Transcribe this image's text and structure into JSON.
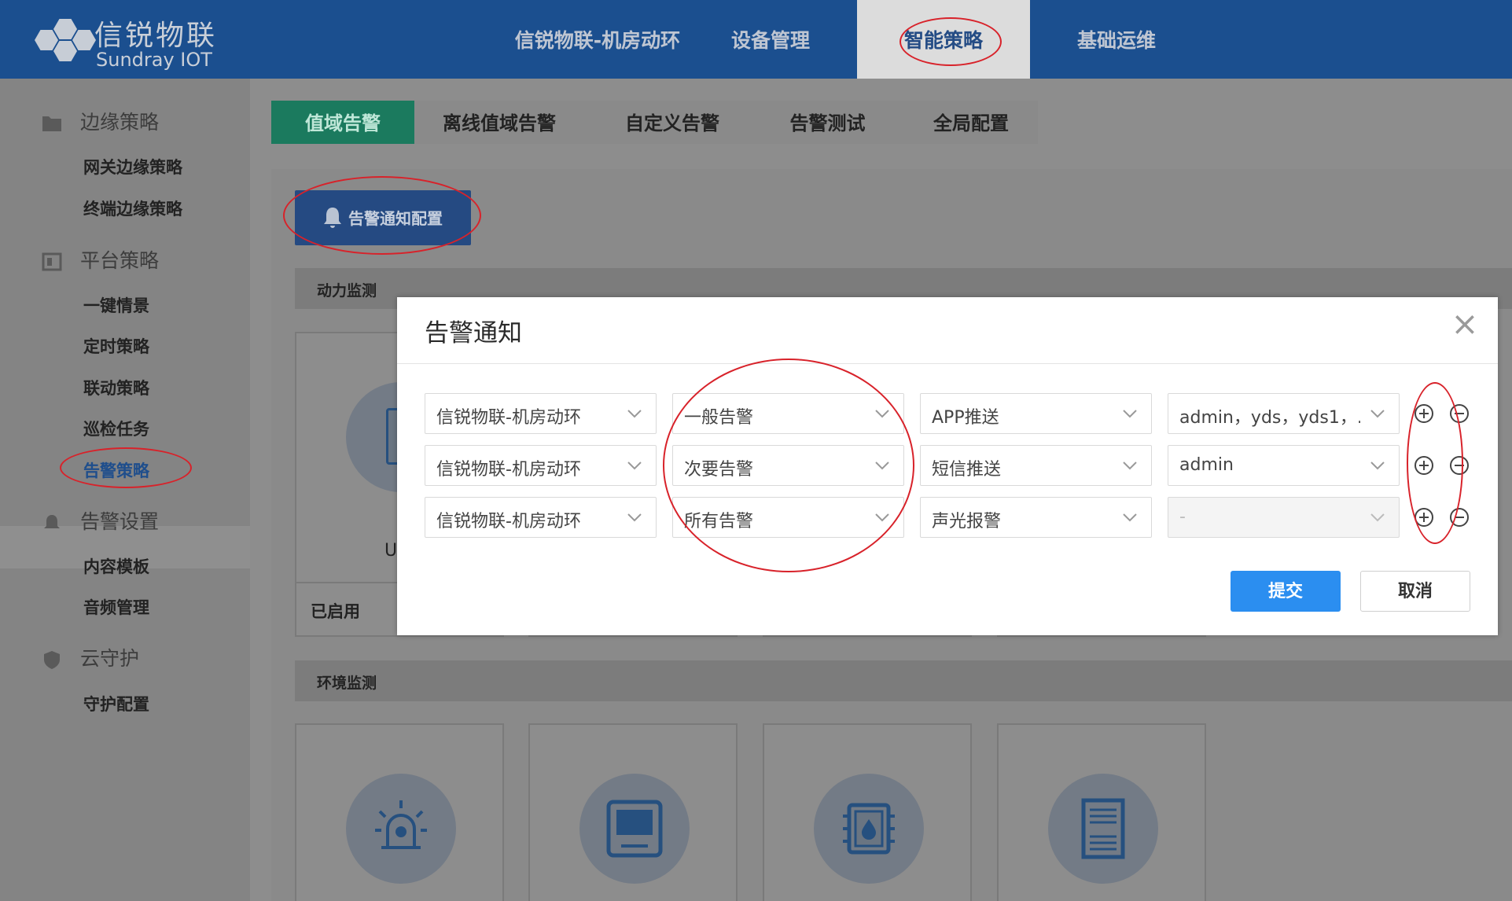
{
  "brand": {
    "name_cn": "信锐物联",
    "name_en": "Sundray IOT"
  },
  "nav": [
    {
      "label": "信锐物联-机房动环"
    },
    {
      "label": "设备管理"
    },
    {
      "label": "智能策略",
      "active": true
    },
    {
      "label": "基础运维"
    }
  ],
  "sidebar": {
    "groups": [
      {
        "label": "边缘策略",
        "icon": "folder-icon",
        "items": [
          "网关边缘策略",
          "终端边缘策略"
        ]
      },
      {
        "label": "平台策略",
        "icon": "server-icon",
        "items": [
          "一键情景",
          "定时策略",
          "联动策略",
          "巡检任务",
          "告警策略"
        ]
      },
      {
        "label": "告警设置",
        "icon": "bell-gear-icon",
        "items": [
          "内容模板",
          "音频管理"
        ]
      },
      {
        "label": "云守护",
        "icon": "shield-icon",
        "items": [
          "守护配置"
        ]
      }
    ],
    "active_item": "告警策略"
  },
  "tabs": [
    "值域告警",
    "离线值域告警",
    "自定义告警",
    "告警测试",
    "全局配置"
  ],
  "active_tab": "值域告警",
  "notice_button": "告警通知配置",
  "sections": {
    "power": "动力监测",
    "env": "环境监测"
  },
  "card_partial_label": "U",
  "card_status": "已启用",
  "modal": {
    "title": "告警通知",
    "rows": [
      {
        "scope": "信锐物联-机房动环",
        "level": "一般告警",
        "method": "APP推送",
        "recipients": "admin，yds，yds1，...",
        "recipients_disabled": false
      },
      {
        "scope": "信锐物联-机房动环",
        "level": "次要告警",
        "method": "短信推送",
        "recipients": "admin",
        "recipients_disabled": false
      },
      {
        "scope": "信锐物联-机房动环",
        "level": "所有告警",
        "method": "声光报警",
        "recipients": "-",
        "recipients_disabled": true
      }
    ],
    "submit": "提交",
    "cancel": "取消"
  },
  "colors": {
    "header": "#1b4f8f",
    "primary": "#2b8ef0",
    "active_tab": "#1b7a5e",
    "annotation": "#d8222a"
  }
}
